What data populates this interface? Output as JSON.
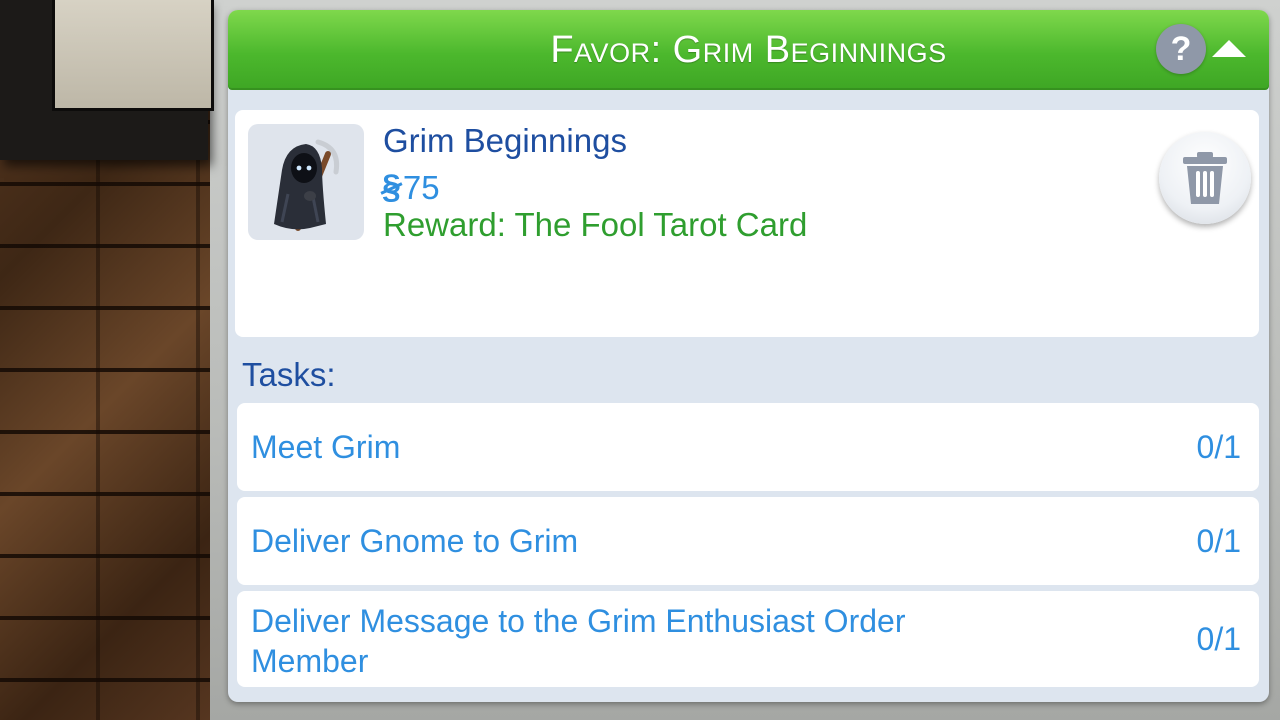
{
  "favor_panel": {
    "title": "Favor: Grim Beginnings",
    "help_icon": "question-mark-icon",
    "help_label": "?",
    "collapse_icon": "chevron-up-icon",
    "favor": {
      "name": "Grim Beginnings",
      "currency_symbol": "§",
      "cost": "75",
      "reward": "Reward: The Fool Tarot Card",
      "portrait_icon": "grim-reaper-icon",
      "delete_icon": "trash-icon"
    },
    "tasks_label": "Tasks:",
    "tasks": [
      {
        "name": "Meet Grim",
        "progress": "0/1"
      },
      {
        "name": "Deliver Gnome to Grim",
        "progress": "0/1"
      },
      {
        "name": "Deliver Message to the Grim Enthusiast Order Member",
        "progress": "0/1"
      }
    ]
  },
  "colors": {
    "header_green": "#4cb82d",
    "title_blue": "#1e4ea0",
    "link_blue": "#2f8fe0",
    "reward_green": "#2f9e2f",
    "panel_bg": "#dde5ef"
  }
}
